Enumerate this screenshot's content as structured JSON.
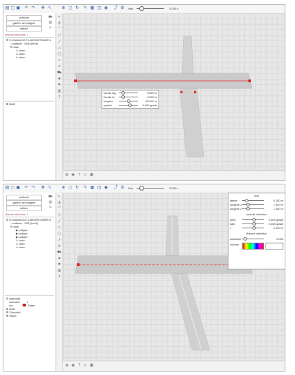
{
  "colors": {
    "road": "#cfcfcf",
    "selection": "#e02020",
    "accent": "#2a5aa0",
    "alert": "#c02020"
  },
  "toolbar": {
    "icons": [
      "folder-open-icon",
      "new-file-icon",
      "save-icon",
      "undo-icon",
      "redo-icon",
      "move-icon",
      "select-icon",
      "zoom-icon",
      "pan-icon",
      "rotate-icon",
      "measure-icon",
      "grid-icon",
      "view-icon",
      "camera-icon",
      "export-icon"
    ],
    "line_label": "linie",
    "zoom_value": "0.000 x"
  },
  "left": {
    "buttons": [
      "vehicule",
      "galerie de imagine",
      "editare"
    ],
    "selection_title": "obiecte selectate: 1"
  },
  "shot1": {
    "tree": [
      "D:\\GAMA DOC LABORATOARE\\1",
      "cadisive - 003 (km:N)",
      "strar",
      "drum",
      "drum",
      "drum"
    ],
    "props_header": "Date",
    "popup": {
      "rows": [
        {
          "label": "banda stg.",
          "value": "3.500 m"
        },
        {
          "label": "banda dr.",
          "value": "3.500 m"
        },
        {
          "label": "lungime",
          "value": "60.000 m"
        },
        {
          "label": "spatiul",
          "value": "0.000 grade"
        }
      ]
    }
  },
  "shot2": {
    "tree": [
      "D:\\GAMA DOC LABORATOARE\\1",
      "cadisive - 003 (km:N)",
      "strar",
      "poligon",
      "poligon",
      "poligon",
      "drum",
      "drum",
      "drum"
    ],
    "props": [
      {
        "label": "Adevarat"
      },
      {
        "label": "adevarat",
        "value": "0"
      },
      {
        "label": "ura",
        "value": "False"
      },
      {
        "label": "Date"
      },
      {
        "label": "Orizontal"
      },
      {
        "label": "Slope"
      }
    ],
    "popup": {
      "title": "linie",
      "rows_top": [
        {
          "label": "latime",
          "value": "0.200 m"
        },
        {
          "label": "lungime 1",
          "value": "1.500 m"
        },
        {
          "label": "lungime 2",
          "value": "1.500 m"
        }
      ],
      "sec1": "obiecte selective",
      "rows_mid": [
        {
          "label": "pitch",
          "value": "0.000 grade"
        },
        {
          "label": "yaw",
          "value": "0.000 grade"
        },
        {
          "label": "x",
          "value": "0.000 m"
        }
      ],
      "sec2": "finisare selective",
      "rows_bot": [
        {
          "label": "adancimi",
          "value": "0.000"
        },
        {
          "label": "culoare",
          "value": ""
        }
      ]
    }
  },
  "status_icons": [
    "globe-icon",
    "camera-icon",
    "text-icon",
    "arrow-icon",
    "grid-icon"
  ]
}
